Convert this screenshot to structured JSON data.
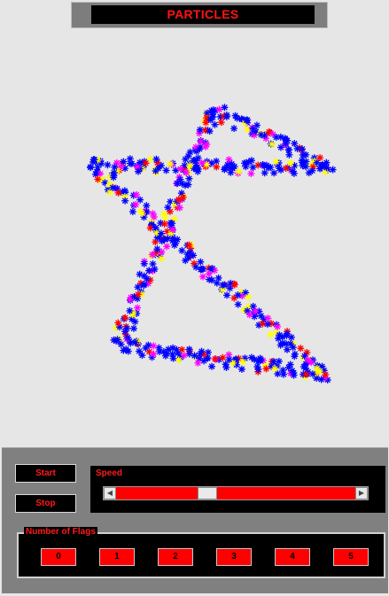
{
  "title": "PARTICLES",
  "controls": {
    "start_label": "Start",
    "stop_label": "Stop",
    "speed_label": "Speed",
    "speed_value": 0.37,
    "flags_label": "Number of Flags",
    "flag_options": [
      "0",
      "1",
      "2",
      "3",
      "4",
      "5"
    ]
  },
  "particle_colors": [
    "#0000ff",
    "#ffff00",
    "#ff00ff",
    "#ff0000"
  ],
  "accent_color": "#ff1a1a"
}
